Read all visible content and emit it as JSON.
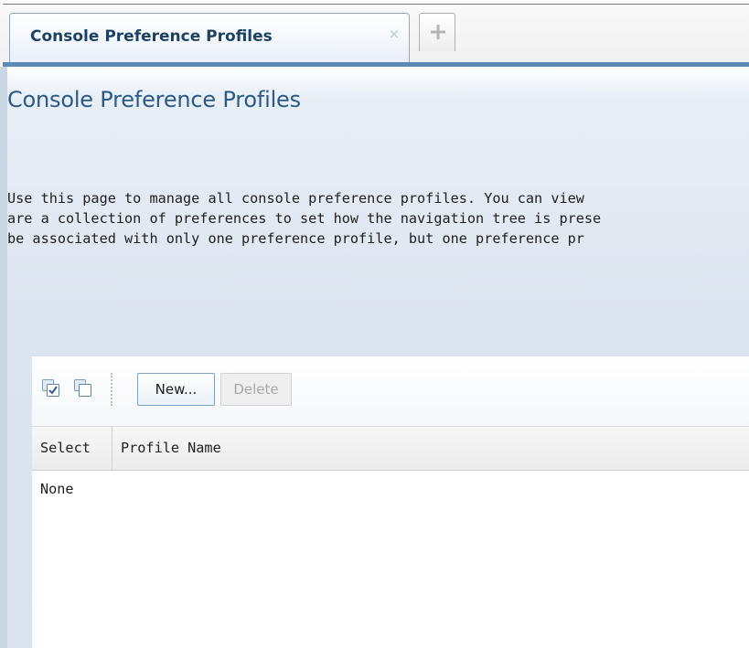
{
  "tabs": {
    "active_label": "Console Preference Profiles",
    "close_glyph": "×",
    "add_icon": "plus-icon"
  },
  "page": {
    "title": "Console Preference Profiles",
    "description_lines": [
      "Use this page to manage all console preference profiles. You can view",
      "are a collection of preferences to set how the navigation tree is prese",
      "be associated with only one preference profile, but one preference pr"
    ]
  },
  "toolbar": {
    "select_all_icon": "select-all-icon",
    "deselect_all_icon": "deselect-all-icon",
    "new_label": "New...",
    "delete_label": "Delete"
  },
  "table": {
    "columns": [
      "Select",
      "Profile Name"
    ],
    "rows": [],
    "empty_text": "None"
  },
  "colors": {
    "tab_text": "#1b4264",
    "title": "#2c5a86",
    "accent_bar": "#5c89b8",
    "panel_background": "#dbe5ef",
    "disabled_text": "#a7a7a7"
  }
}
